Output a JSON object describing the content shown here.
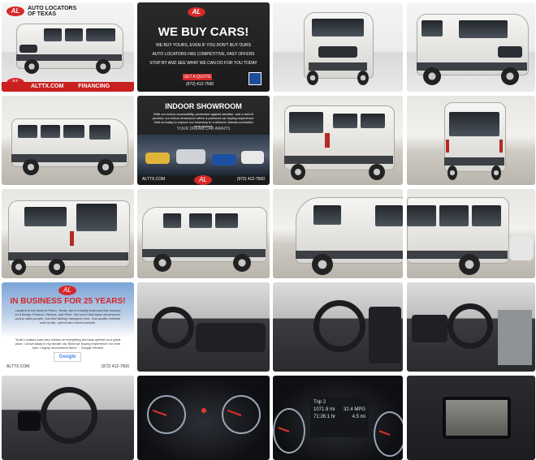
{
  "gallery": {
    "dealer_logo": {
      "mark": "AL",
      "name_line1": "AUTO LOCATORS",
      "name_line2": "OF TEXAS"
    },
    "tile1": {
      "site": "ALTTX.COM",
      "footer": "FINANCING AVAILABLE!"
    },
    "tile2": {
      "headline": "WE BUY CARS!",
      "line1": "WE BUY YOURS, EVEN IF YOU DON'T BUY OURS",
      "line2": "AUTO LOCATORS HAS COMPETITIVE, FAST OFFERS",
      "line3": "STOP BY AND SEE WHAT WE CAN DO FOR YOU TODAY",
      "cta": "GET A QUOTE",
      "phone": "(972) 412-7500"
    },
    "tile6": {
      "headline": "INDOOR SHOWROOM",
      "body": "With our indoor accessibility, protection against weather, and a well-lit product, our indoor showroom offers a premium car buying experience. Visit us today to explore our inventory in a relaxed, climate-controlled environment.",
      "tagline": "YOUR DREAM CAR AWAITS",
      "footer_left": "ALTTX.COM",
      "footer_right": "(972) 412-7500"
    },
    "tile13": {
      "headline": "IN BUSINESS FOR 25 YEARS!",
      "body": "Located in the heart of Plano, Texas, we're a family business that focuses on 3 things: Product, Service, and Price. You won't find fancy showrooms, pushy sales people, and fast talking managers here. Just quality vehicles sold by fair, upfront and honest people.",
      "quote": "\"Auto Locators was very honest on everything and was upfront on a great price. I drove away in my dream car. Best car buying experience I've ever had. I highly recommend them.\" - Google Review",
      "badge": "Google",
      "footer_left": "ALTTX.COM",
      "footer_right": "(972) 412-7500"
    },
    "tile18": {
      "trip": "Trip 2",
      "odometer": "1071.9 mi",
      "economy": "32.4 MPG",
      "time": "71:26:1 hr",
      "rate": "4.5 mi"
    }
  },
  "colors": {
    "brand_red": "#d6282a",
    "dark_bg": "#1a1a1a"
  }
}
